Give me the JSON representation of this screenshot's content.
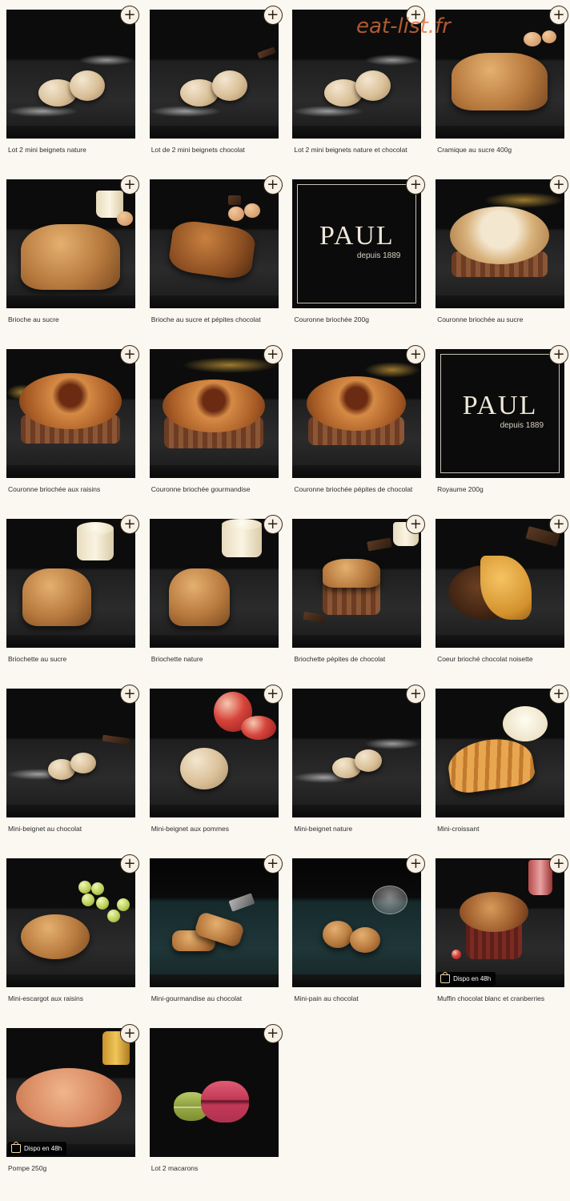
{
  "watermark": "eat-list.fr",
  "logo": {
    "brand": "PAUL",
    "tagline": "depuis 1889"
  },
  "add_label": "+",
  "badge_text": "Dispo en 48h",
  "products": [
    {
      "name": "Lot 2 mini beignets nature"
    },
    {
      "name": "Lot de 2 mini beignets chocolat"
    },
    {
      "name": "Lot 2 mini beignets nature et chocolat"
    },
    {
      "name": "Cramique au sucre 400g"
    },
    {
      "name": "Brioche au sucre"
    },
    {
      "name": "Brioche au sucre et pépites chocolat"
    },
    {
      "name": "Couronne briochée 200g"
    },
    {
      "name": "Couronne briochée au sucre"
    },
    {
      "name": "Couronne briochée aux raisins"
    },
    {
      "name": "Couronne briochée gourmandise"
    },
    {
      "name": "Couronne briochée pépites de chocolat"
    },
    {
      "name": "Royaume 200g"
    },
    {
      "name": "Briochette au sucre"
    },
    {
      "name": "Briochette nature"
    },
    {
      "name": "Briochette pépites de chocolat"
    },
    {
      "name": "Coeur brioché chocolat noisette"
    },
    {
      "name": "Mini-beignet au chocolat"
    },
    {
      "name": "Mini-beignet aux pommes"
    },
    {
      "name": "Mini-beignet nature"
    },
    {
      "name": "Mini-croissant"
    },
    {
      "name": "Mini-escargot aux raisins"
    },
    {
      "name": "Mini-gourmandise au chocolat"
    },
    {
      "name": "Mini-pain au chocolat"
    },
    {
      "name": "Muffin chocolat blanc et cranberries"
    },
    {
      "name": "Pompe 250g"
    },
    {
      "name": "Lot 2 macarons"
    }
  ]
}
